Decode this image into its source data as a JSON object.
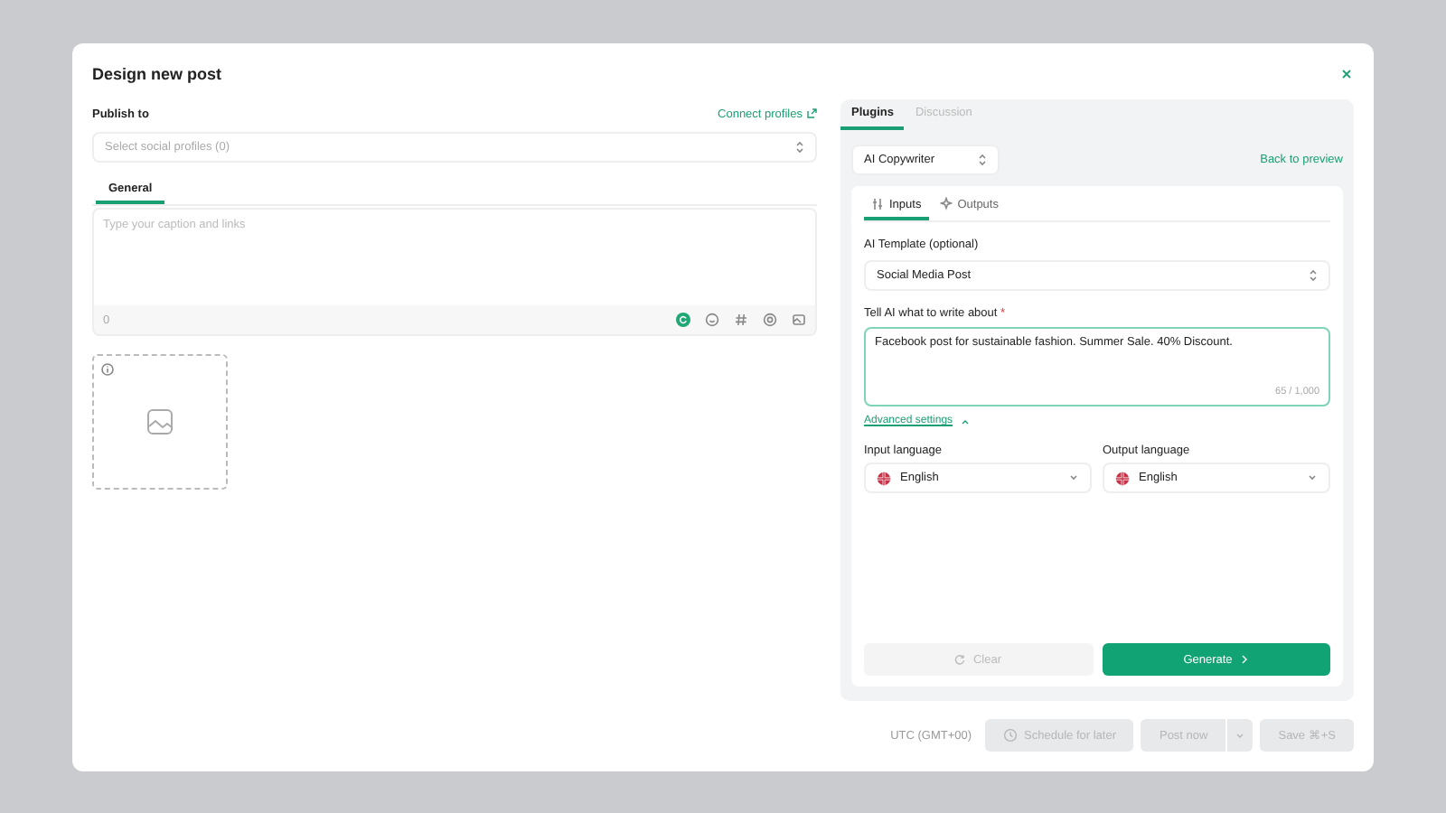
{
  "dialog": {
    "title": "Design new post"
  },
  "publish": {
    "label": "Publish to",
    "link": "Connect profiles",
    "placeholder": "Select social profiles (0)"
  },
  "editor": {
    "tabs": [
      {
        "label": "General",
        "selected": true
      }
    ],
    "placeholder": "Type your caption and links",
    "count": "0"
  },
  "plugin_panel": {
    "tabs": [
      {
        "label": "Plugins",
        "selected": true
      },
      {
        "label": "Discussion",
        "selected": false
      }
    ],
    "plugin": "AI Copywriter",
    "back_link": "Back to preview",
    "sub_tabs": [
      {
        "label": "Inputs",
        "kind": "sliders",
        "selected": true
      },
      {
        "label": "Outputs",
        "kind": "sparkle",
        "selected": false
      }
    ],
    "template_label": "AI Template (optional)",
    "template": "Social Media Post",
    "prompt_label": "Tell AI what to write about",
    "required_mark": "*",
    "prompt": "Facebook post for sustainable fashion. Summer Sale. 40% Discount.",
    "prompt_count": "65 / 1,000",
    "advanced": {
      "label": "Advanced settings",
      "expanded": true
    },
    "languages": [
      {
        "label": "Input language",
        "value": "English"
      },
      {
        "label": "Output language",
        "value": "English"
      }
    ],
    "buttons": [
      {
        "label": "Clear",
        "kind": "secondary",
        "disabled": true
      },
      {
        "label": "Generate",
        "kind": "primary",
        "disabled": false
      }
    ]
  },
  "footer": {
    "timezone": "UTC (GMT+00)",
    "buttons": [
      {
        "label": "Schedule for later",
        "kind": "schedule",
        "disabled": true
      },
      {
        "label": "Post now",
        "kind": "split",
        "disabled": true
      },
      {
        "label": "Save ⌘+S",
        "kind": "plain",
        "disabled": true
      }
    ]
  }
}
